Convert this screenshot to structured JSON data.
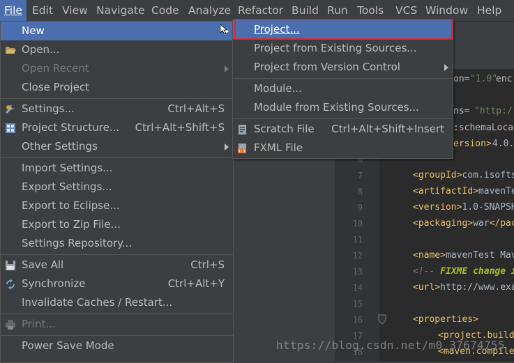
{
  "menubar": {
    "items": [
      {
        "label": "File",
        "key": "F"
      },
      {
        "label": "Edit"
      },
      {
        "label": "View"
      },
      {
        "label": "Navigate"
      },
      {
        "label": "Code"
      },
      {
        "label": "Analyze"
      },
      {
        "label": "Refactor"
      },
      {
        "label": "Build"
      },
      {
        "label": "Run"
      },
      {
        "label": "Tools"
      },
      {
        "label": "VCS"
      },
      {
        "label": "Window"
      },
      {
        "label": "Help"
      }
    ]
  },
  "file_menu": {
    "new": "New",
    "open": "Open...",
    "open_recent": "Open Recent",
    "close_project": "Close Project",
    "settings": "Settings...",
    "settings_sc": "Ctrl+Alt+S",
    "project_structure": "Project Structure...",
    "project_structure_sc": "Ctrl+Alt+Shift+S",
    "other_settings": "Other Settings",
    "import_settings": "Import Settings...",
    "export_settings": "Export Settings...",
    "export_eclipse": "Export to Eclipse...",
    "export_zip": "Export to Zip File...",
    "settings_repo": "Settings Repository...",
    "save_all": "Save All",
    "save_all_sc": "Ctrl+S",
    "synchronize": "Synchronize",
    "synchronize_sc": "Ctrl+Alt+Y",
    "invalidate": "Invalidate Caches / Restart...",
    "print": "Print...",
    "power_save": "Power Save Mode"
  },
  "new_submenu": {
    "project": "Project...",
    "from_existing": "Project from Existing Sources...",
    "from_vcs": "Project from Version Control",
    "module": "Module...",
    "module_existing": "Module from Existing Sources...",
    "scratch": "Scratch File",
    "scratch_sc": "Ctrl+Alt+Shift+Insert",
    "fxml": "FXML File"
  },
  "editor": {
    "frag_version_attr": "on=",
    "frag_version_val": "\"1.0\"",
    "frag_enc": " enc",
    "frag_ns": "ns=",
    "frag_ns_val": "\"http:/",
    "frag_schema": ":schemaLoca",
    "frag_modelversion": "ersion>",
    "frag_modelversion_val": "4.0.0",
    "lines": [
      {
        "n": "6",
        "text": ""
      },
      {
        "n": "7",
        "tag_open": "<groupId>",
        "text": "com.isofts"
      },
      {
        "n": "8",
        "tag_open": "<artifactId>",
        "text": "mavenTe"
      },
      {
        "n": "9",
        "tag_open": "<version>",
        "text": "1.0-SNAPSH"
      },
      {
        "n": "10",
        "tag_open": "<packaging>",
        "text": "war",
        "tag_close": "</pac"
      },
      {
        "n": "11",
        "text": ""
      },
      {
        "n": "12",
        "tag_open": "<name>",
        "text": "mavenTest Mav"
      },
      {
        "n": "13",
        "comment": "<!-- ",
        "todo": "FIXME change i"
      },
      {
        "n": "14",
        "tag_open": "<url>",
        "text": "http://www.exa"
      },
      {
        "n": "15",
        "text": ""
      },
      {
        "n": "16",
        "tag_open": "<properties>",
        "text": ""
      },
      {
        "n": "17",
        "tag_open": "<project.build.",
        "text": ""
      },
      {
        "n": "18",
        "tag_open": "<maven.compiler",
        "text": ""
      }
    ]
  },
  "watermark": "https://blog.csdn.net/m0_37674755"
}
